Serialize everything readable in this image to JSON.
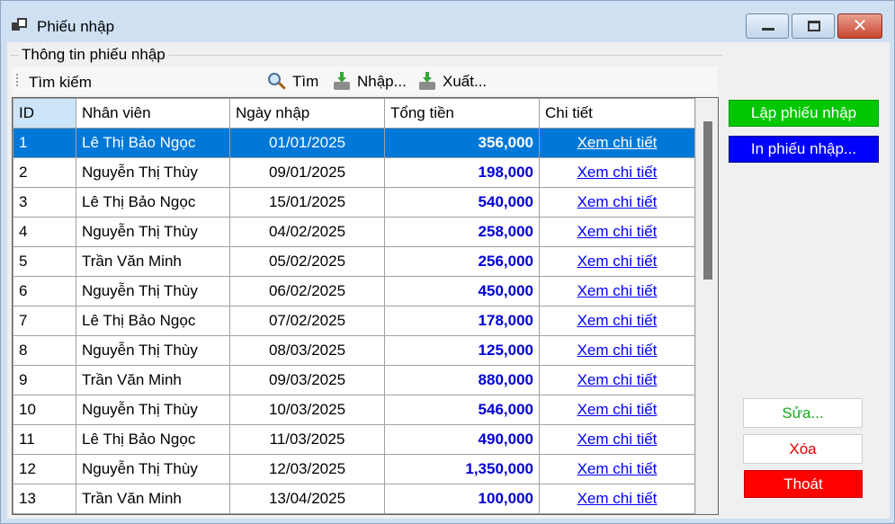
{
  "window": {
    "title": "Phiếu nhập"
  },
  "group": {
    "label": "Thông tin phiếu nhập"
  },
  "toolbar": {
    "search_label": "Tìm kiếm",
    "find_label": "Tìm",
    "import_label": "Nhập...",
    "export_label": "Xuất..."
  },
  "table": {
    "columns": [
      "ID",
      "Nhân viên",
      "Ngày nhập",
      "Tổng tiền",
      "Chi tiết"
    ],
    "rows": [
      {
        "id": "1",
        "employee": "Lê Thị Bảo Ngọc",
        "date": "01/01/2025",
        "total": "356,000",
        "detail": "Xem chi tiết"
      },
      {
        "id": "2",
        "employee": "Nguyễn Thị Thùy",
        "date": "09/01/2025",
        "total": "198,000",
        "detail": "Xem chi tiết"
      },
      {
        "id": "3",
        "employee": "Lê Thị Bảo Ngọc",
        "date": "15/01/2025",
        "total": "540,000",
        "detail": "Xem chi tiết"
      },
      {
        "id": "4",
        "employee": "Nguyễn Thị Thùy",
        "date": "04/02/2025",
        "total": "258,000",
        "detail": "Xem chi tiết"
      },
      {
        "id": "5",
        "employee": "Trần Văn Minh",
        "date": "05/02/2025",
        "total": "256,000",
        "detail": "Xem chi tiết"
      },
      {
        "id": "6",
        "employee": "Nguyễn Thị Thùy",
        "date": "06/02/2025",
        "total": "450,000",
        "detail": "Xem chi tiết"
      },
      {
        "id": "7",
        "employee": "Lê Thị Bảo Ngọc",
        "date": "07/02/2025",
        "total": "178,000",
        "detail": "Xem chi tiết"
      },
      {
        "id": "8",
        "employee": "Nguyễn Thị Thùy",
        "date": "08/03/2025",
        "total": "125,000",
        "detail": "Xem chi tiết"
      },
      {
        "id": "9",
        "employee": "Trần Văn Minh",
        "date": "09/03/2025",
        "total": "880,000",
        "detail": "Xem chi tiết"
      },
      {
        "id": "10",
        "employee": "Nguyễn Thị Thùy",
        "date": "10/03/2025",
        "total": "546,000",
        "detail": "Xem chi tiết"
      },
      {
        "id": "11",
        "employee": "Lê Thị Bảo Ngọc",
        "date": "11/03/2025",
        "total": "490,000",
        "detail": "Xem chi tiết"
      },
      {
        "id": "12",
        "employee": "Nguyễn Thị Thùy",
        "date": "12/03/2025",
        "total": "1,350,000",
        "detail": "Xem chi tiết"
      },
      {
        "id": "13",
        "employee": "Trần Văn Minh",
        "date": "13/04/2025",
        "total": "100,000",
        "detail": "Xem chi tiết"
      }
    ],
    "selected_row": 0
  },
  "actions": {
    "create_label": "Lập phiếu nhập",
    "print_label": "In phiếu nhập...",
    "edit_label": "Sửa...",
    "delete_label": "Xóa",
    "exit_label": "Thoát"
  },
  "colors": {
    "selection": "#0078d7",
    "money": "#0000d0",
    "link": "#0000ff",
    "create_button": "#00c800",
    "print_button": "#0000ff",
    "exit_button": "#ff0000"
  },
  "icons": {
    "find": "magnifier-icon",
    "import": "import-box-icon",
    "export": "export-box-icon"
  }
}
